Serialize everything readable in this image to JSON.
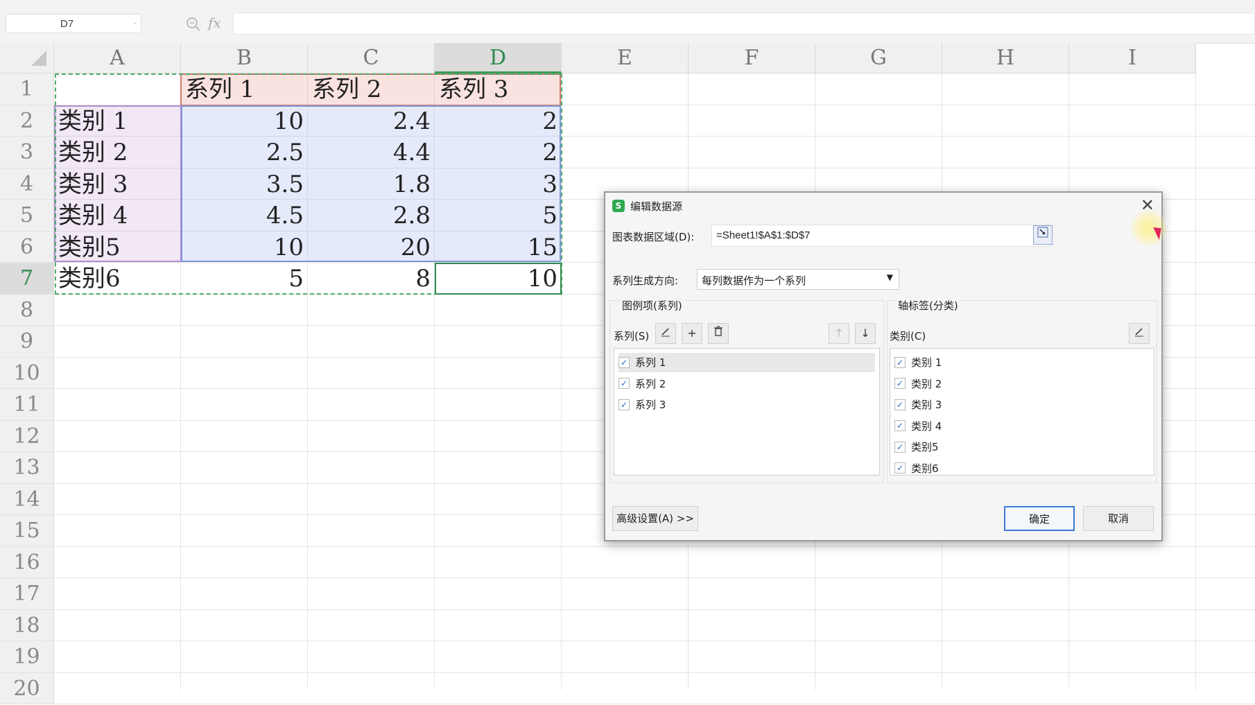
{
  "formula_bar": {
    "name_box": "D7",
    "fx_label": "fx",
    "formula": ""
  },
  "sheet": {
    "columns": [
      "A",
      "B",
      "C",
      "D",
      "E",
      "F",
      "G",
      "H",
      "I"
    ],
    "rows": [
      "1",
      "2",
      "3",
      "4",
      "5",
      "6",
      "7",
      "8",
      "9",
      "10",
      "11",
      "12",
      "13",
      "14",
      "15",
      "16",
      "17",
      "18",
      "19",
      "20"
    ],
    "cells": {
      "B1": "系列 1",
      "C1": "系列 2",
      "D1": "系列 3",
      "A2": "类别 1",
      "B2": "10",
      "C2": "2.4",
      "D2": "2",
      "A3": "类别 2",
      "B3": "2.5",
      "C3": "4.4",
      "D3": "2",
      "A4": "类别 3",
      "B4": "3.5",
      "C4": "1.8",
      "D4": "3",
      "A5": "类别 4",
      "B5": "4.5",
      "C5": "2.8",
      "D5": "5",
      "A6": "类别5",
      "B6": "10",
      "C6": "20",
      "D6": "15",
      "A7": "类别6",
      "B7": "5",
      "C7": "8",
      "D7": "10"
    }
  },
  "dialog": {
    "title": "编辑数据源",
    "range_label": "图表数据区域(D):",
    "range_value": "=Sheet1!$A$1:$D$7",
    "direction_label": "系列生成方向:",
    "direction_value": "每列数据作为一个系列",
    "legend_group_title": "图例项(系列)",
    "series_label": "系列(S)",
    "series_items": [
      "系列 1",
      "系列 2",
      "系列 3"
    ],
    "axis_group_title": "轴标签(分类)",
    "category_label": "类别(C)",
    "category_items": [
      "类别 1",
      "类别 2",
      "类别 3",
      "类别 4",
      "类别5",
      "类别6"
    ],
    "advanced_button": "高级设置(A) >>",
    "ok_button": "确定",
    "cancel_button": "取消"
  }
}
